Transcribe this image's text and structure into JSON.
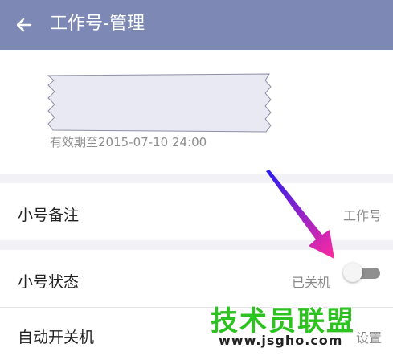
{
  "header": {
    "title": "工作号-管理",
    "back_icon": "arrow-left-icon",
    "bg_color": "#7e88b5"
  },
  "account": {
    "expiry_text": "有效期至2015-07-10 24:00"
  },
  "rows": {
    "remark": {
      "label": "小号备注",
      "value": "工作号"
    },
    "status": {
      "label": "小号状态",
      "value": "已关机",
      "toggle_on": false
    },
    "auto_power": {
      "label": "自动开关机",
      "value": "设置"
    }
  },
  "annotation": {
    "arrow_icon": "pointer-arrow-icon",
    "colors": [
      "#2b1cf0",
      "#ff2aa0"
    ]
  },
  "watermark": {
    "text": "技术员联盟",
    "url": "www.jsgho.com",
    "color": "#2cc21f"
  }
}
